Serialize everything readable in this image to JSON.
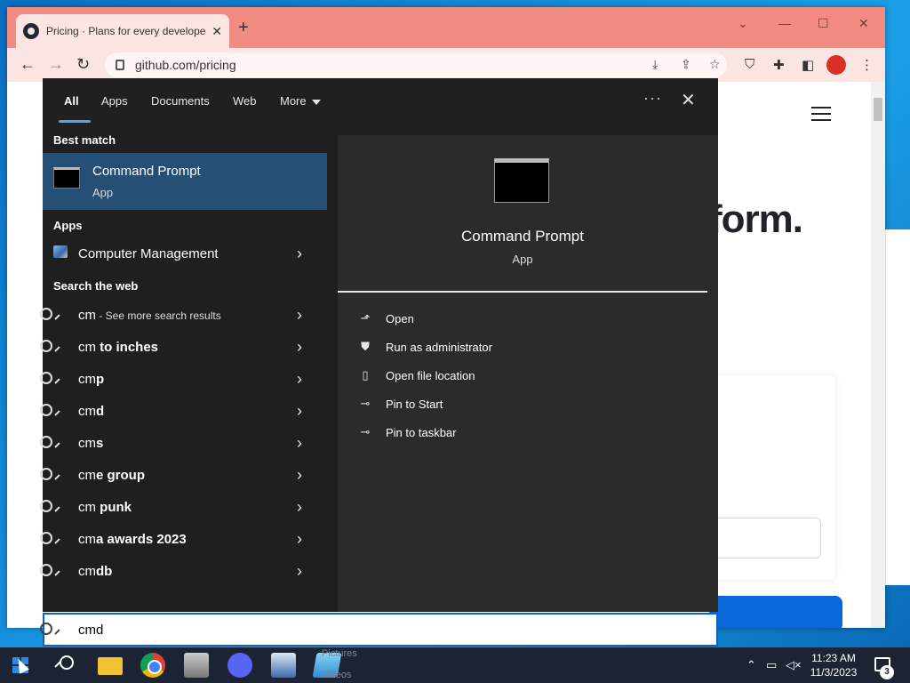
{
  "browser": {
    "tab_title": "Pricing · Plans for every develope",
    "new_tab_icon": "plus-icon",
    "url": "github.com/pricing",
    "page_headline_fragment": "form."
  },
  "search_panel": {
    "tabs": [
      {
        "label": "All",
        "active": true
      },
      {
        "label": "Apps"
      },
      {
        "label": "Documents"
      },
      {
        "label": "Web"
      },
      {
        "label": "More"
      }
    ],
    "best_match_label": "Best match",
    "best_match": {
      "title": "Command Prompt",
      "subtitle": "App"
    },
    "apps_label": "Apps",
    "apps": [
      {
        "label": "Computer Management"
      }
    ],
    "web_label": "Search the web",
    "web_results": [
      {
        "query": "cm",
        "suffix": " - See more search results"
      },
      {
        "query": "cm",
        "bold": " to inches"
      },
      {
        "query": "cm",
        "bold": "p"
      },
      {
        "query": "cm",
        "bold": "d"
      },
      {
        "query": "cm",
        "bold": "s"
      },
      {
        "query": "cm",
        "bold": "e group"
      },
      {
        "query": "cm",
        "bold": " punk"
      },
      {
        "query": "cm",
        "bold": "a awards 2023"
      },
      {
        "query": "cm",
        "bold": "db"
      }
    ],
    "detail": {
      "title": "Command Prompt",
      "subtitle": "App",
      "actions": [
        {
          "label": "Open",
          "icon": "open-icon"
        },
        {
          "label": "Run as administrator",
          "icon": "shield-icon"
        },
        {
          "label": "Open file location",
          "icon": "file-location-icon"
        },
        {
          "label": "Pin to Start",
          "icon": "pin-icon"
        },
        {
          "label": "Pin to taskbar",
          "icon": "pin-icon"
        }
      ]
    },
    "search_value": "cmd"
  },
  "taskbar": {
    "ghost_1": "Pictures",
    "ghost_2": "Videos",
    "time": "11:23 AM",
    "date": "11/3/2023",
    "notification_count": "3"
  }
}
